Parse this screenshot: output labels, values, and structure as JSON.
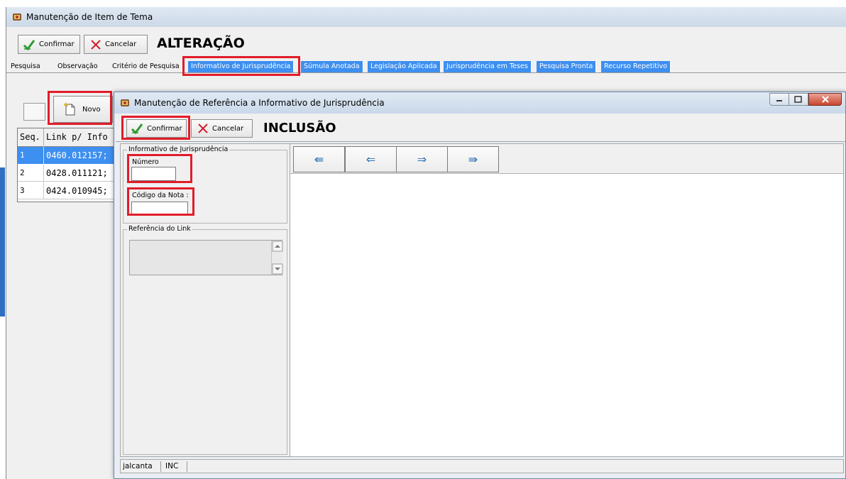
{
  "outer_window": {
    "title": "Manutenção de Item de Tema",
    "confirm_label": "Confirmar",
    "cancel_label": "Cancelar",
    "mode_label": "ALTERAÇÃO",
    "tabs": [
      {
        "label": "Pesquisa",
        "style": "plain"
      },
      {
        "label": "Observação",
        "style": "plain"
      },
      {
        "label": "Critério de Pesquisa",
        "style": "plain"
      },
      {
        "label": "Informativo de Jurisprudência",
        "style": "active"
      },
      {
        "label": "Súmula Anotada",
        "style": "blue"
      },
      {
        "label": "Legislação Aplicada",
        "style": "blue"
      },
      {
        "label": "Jurisprudência em Teses",
        "style": "blue"
      },
      {
        "label": "Pesquisa Pronta",
        "style": "blue"
      },
      {
        "label": "Recurso Repetitivo",
        "style": "blue"
      }
    ],
    "new_label": "Novo",
    "grid": {
      "columns": [
        "Seq.",
        "Link p/ Info"
      ],
      "rows": [
        {
          "seq": "1",
          "link": "0460.012157;",
          "selected": true
        },
        {
          "seq": "2",
          "link": "0428.011121;",
          "selected": false
        },
        {
          "seq": "3",
          "link": "0424.010945;",
          "selected": false
        }
      ]
    }
  },
  "dialog": {
    "title": "Manutenção de Referência a Informativo de Jurisprudência",
    "confirm_label": "Confirmar",
    "cancel_label": "Cancelar",
    "mode_label": "INCLUSÃO",
    "informativo_group_label": "Informativo de Jurisprudência",
    "numero_label": "Número",
    "numero_value": "",
    "codigo_label": "Código da Nota :",
    "codigo_value": "",
    "referencia_group_label": "Referência do Link",
    "referencia_value": "",
    "nav": {
      "first": "⇚",
      "prev": "⇐",
      "next": "⇒",
      "last": "⇛"
    },
    "status": {
      "user": "jalcanta",
      "mode": "INC"
    }
  },
  "colors": {
    "highlight": "#e11d2a",
    "tab_blue": "#3d8ff0",
    "selection": "#3d8ff0"
  }
}
